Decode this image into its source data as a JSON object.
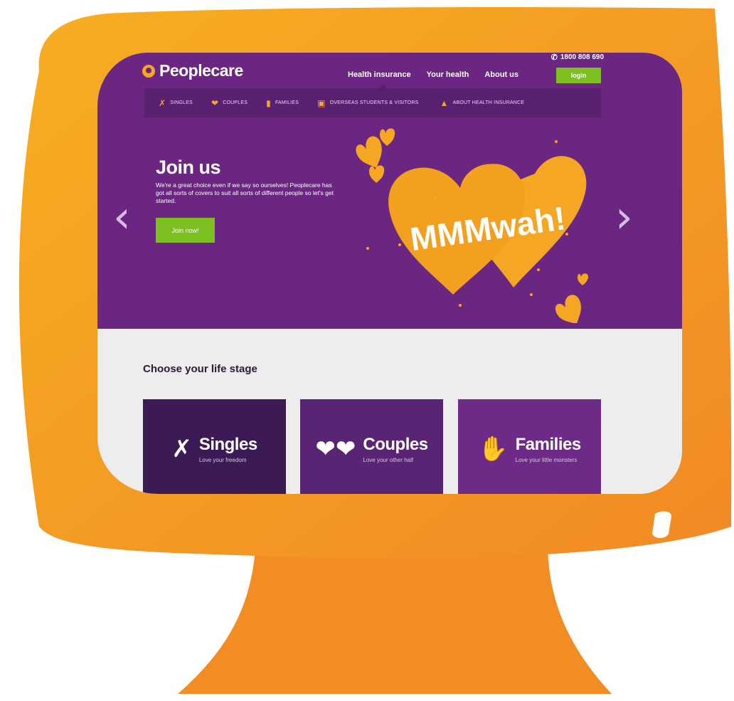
{
  "colors": {
    "monitor_orange": "#f39224",
    "site_purple": "#6a2680",
    "subnav_purple": "#5a2070",
    "accent_green": "#7cbf1f",
    "heart_orange": "#f5a623",
    "card_singles": "#3b1a56",
    "card_couples": "#5a2474",
    "card_families": "#6d2a86"
  },
  "header": {
    "logo_text": "Peoplecare",
    "phone": "1800 808 690",
    "phone_icon": "phone-icon",
    "nav": [
      "Health insurance",
      "Your health",
      "About us"
    ],
    "login_label": "login"
  },
  "sub_nav": {
    "items": [
      {
        "label": "SINGLES",
        "icon": "single-person-icon"
      },
      {
        "label": "COUPLES",
        "icon": "two-hearts-icon"
      },
      {
        "label": "FAMILIES",
        "icon": "family-icon"
      },
      {
        "label": "OVERSEAS STUDENTS & VISITORS",
        "icon": "suitcase-icon"
      },
      {
        "label": "ABOUT HEALTH INSURANCE",
        "icon": "blocks-icon"
      }
    ]
  },
  "hero": {
    "title": "Join us",
    "text": "We're a great choice even if we say so ourselves! Peoplecare has got all sorts of covers to suit all sorts of different people so let's get started.",
    "button_label": "Join now!",
    "heart_text": "MMMwah!",
    "prev_icon": "chevron-left-icon",
    "next_icon": "chevron-right-icon"
  },
  "life_stage": {
    "title": "Choose your life stage",
    "cards": [
      {
        "title": "Singles",
        "subtitle": "Love your freedom",
        "icon": "single-person-icon"
      },
      {
        "title": "Couples",
        "subtitle": "Love your other half",
        "icon": "two-hearts-icon"
      },
      {
        "title": "Families",
        "subtitle": "Love your little monsters",
        "icon": "family-icon"
      }
    ]
  }
}
